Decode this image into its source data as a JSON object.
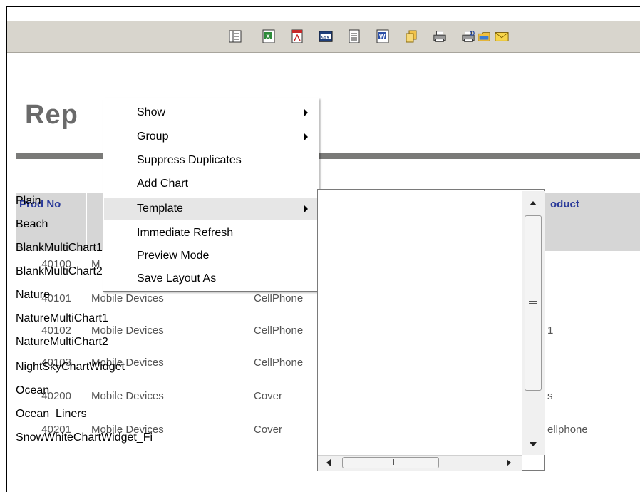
{
  "toolbar": {
    "icons": [
      "layout-icon",
      "excel-icon",
      "pdf-icon",
      "csv-icon",
      "text-icon",
      "word-icon",
      "copy-icon",
      "print-icon",
      "print-preview-icon",
      "folder-icon",
      "email-icon"
    ],
    "csv_label": "csv",
    "word_label": "W"
  },
  "report": {
    "title": "Rep"
  },
  "columns": {
    "prod_no": "Prod No",
    "product": "oduct"
  },
  "rows": [
    {
      "no": "40100",
      "line": "M",
      "type": "",
      "product": ""
    },
    {
      "no": "40101",
      "line": "Mobile Devices",
      "type": "CellPhone",
      "product": ""
    },
    {
      "no": "40102",
      "line": "Mobile Devices",
      "type": "CellPhone",
      "product": "1"
    },
    {
      "no": "40103",
      "line": "Mobile Devices",
      "type": "CellPhone",
      "product": ""
    },
    {
      "no": "40200",
      "line": "Mobile Devices",
      "type": "Cover",
      "product": "s"
    },
    {
      "no": "40201",
      "line": "Mobile Devices",
      "type": "Cover",
      "product": "ellphone"
    }
  ],
  "context_menu": {
    "items": [
      {
        "label": "Show",
        "submenu": true
      },
      {
        "label": "Group",
        "submenu": true
      },
      {
        "label": "Suppress Duplicates",
        "submenu": false
      },
      {
        "label": "Add Chart",
        "submenu": false
      },
      {
        "label": "Template",
        "submenu": true,
        "highlighted": true
      },
      {
        "label": "Immediate Refresh",
        "submenu": false
      },
      {
        "label": "Preview Mode",
        "submenu": false
      },
      {
        "label": "Save Layout As",
        "submenu": false
      }
    ]
  },
  "template_menu": {
    "items": [
      "Plain",
      "Beach",
      "BlankMultiChart1",
      "BlankMultiChart2",
      "Nature",
      "NatureMultiChart1",
      "NatureMultiChart2",
      "NightSkyChartWidget",
      "Ocean",
      "Ocean_Liners",
      "SnowWhiteChartWidget_Fi"
    ]
  },
  "colors": {
    "toolbar_bg": "#d8d5cd",
    "title_text": "#6a6a6a",
    "header_text": "#2a3a9a",
    "menu_highlight": "#e6e6e6"
  }
}
